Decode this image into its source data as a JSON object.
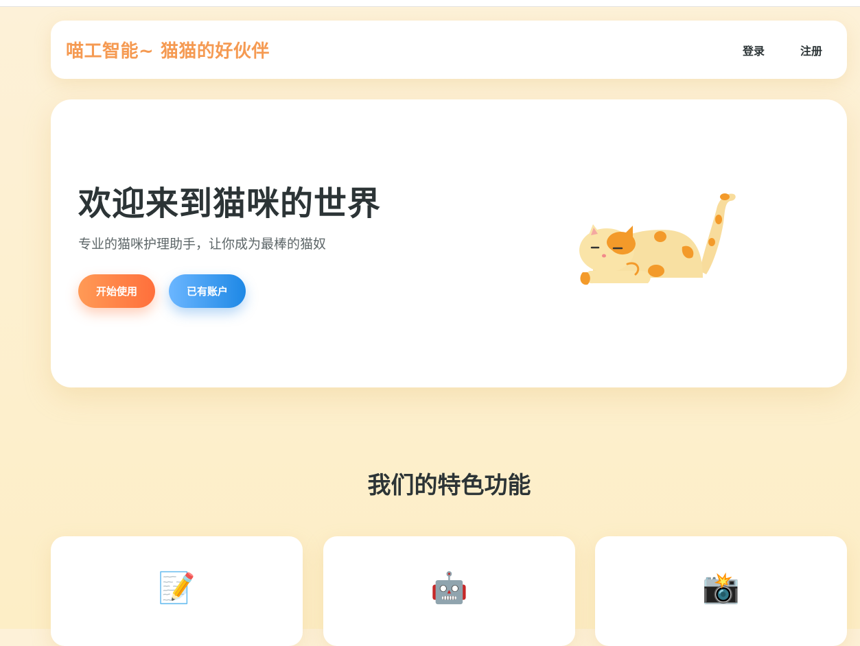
{
  "nav": {
    "brand": "喵工智能~ 猫猫的好伙伴",
    "login": "登录",
    "register": "注册"
  },
  "hero": {
    "title": "欢迎来到猫咪的世界",
    "subtitle": "专业的猫咪护理助手，让你成为最棒的猫奴",
    "start_button": "开始使用",
    "account_button": "已有账户"
  },
  "features": {
    "title": "我们的特色功能",
    "cards": [
      {
        "icon": "📝",
        "icon_name": "memo-icon"
      },
      {
        "icon": "🤖",
        "icon_name": "robot-icon"
      },
      {
        "icon": "📸",
        "icon_name": "camera-flash-icon"
      }
    ]
  },
  "colors": {
    "brand": "#f59a52",
    "start_button": "#ff7a45",
    "account_button": "#3a9af0",
    "background": "#fdf0d2"
  }
}
